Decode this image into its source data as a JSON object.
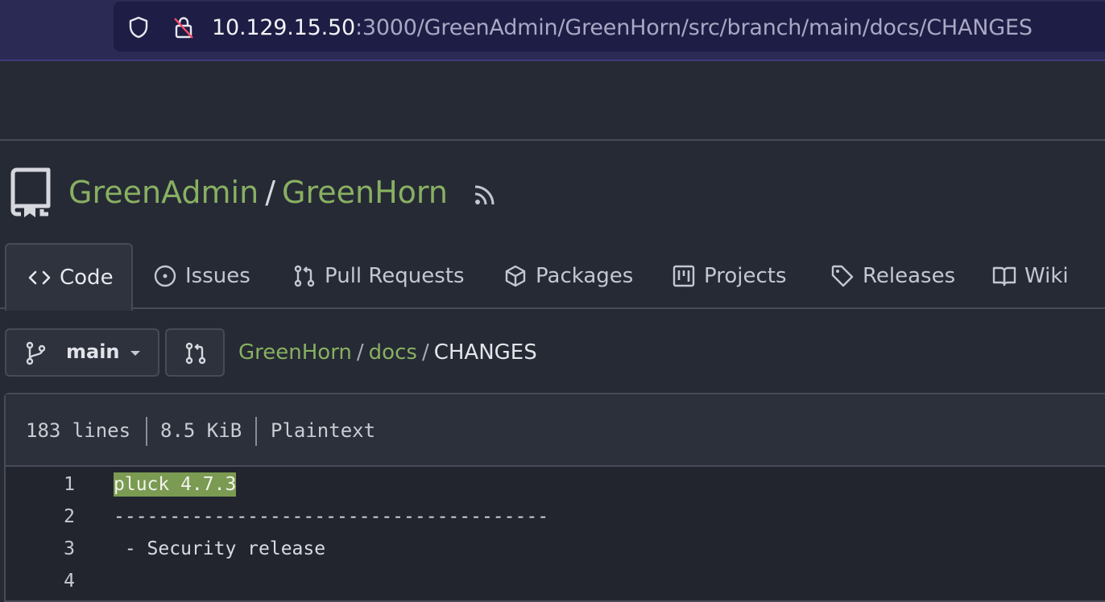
{
  "browser": {
    "url_host": "10.129.15.50",
    "url_path": ":3000/GreenAdmin/GreenHorn/src/branch/main/docs/CHANGES"
  },
  "repo": {
    "owner": "GreenAdmin",
    "separator": "/",
    "name": "GreenHorn"
  },
  "tabs": [
    {
      "label": "Code",
      "icon": "code-icon",
      "active": true
    },
    {
      "label": "Issues",
      "icon": "issue-icon"
    },
    {
      "label": "Pull Requests",
      "icon": "pull-request-icon"
    },
    {
      "label": "Packages",
      "icon": "package-icon"
    },
    {
      "label": "Projects",
      "icon": "project-icon"
    },
    {
      "label": "Releases",
      "icon": "tag-icon"
    },
    {
      "label": "Wiki",
      "icon": "book-icon"
    }
  ],
  "branch": {
    "name": "main"
  },
  "path": {
    "segments": [
      "GreenHorn",
      "docs"
    ],
    "current": "CHANGES",
    "separator": "/"
  },
  "file_info": {
    "lines": "183 lines",
    "size": "8.5 KiB",
    "type": "Plaintext"
  },
  "code_lines": [
    {
      "num": "1",
      "text": "pluck 4.7.3"
    },
    {
      "num": "2",
      "text": "---------------------------------------"
    },
    {
      "num": "3",
      "text": " - Security release"
    },
    {
      "num": "4",
      "text": ""
    }
  ],
  "colors": {
    "accent_link": "#88b061",
    "highlight": "#7b9a52",
    "browser_bar": "#2b2a55"
  }
}
